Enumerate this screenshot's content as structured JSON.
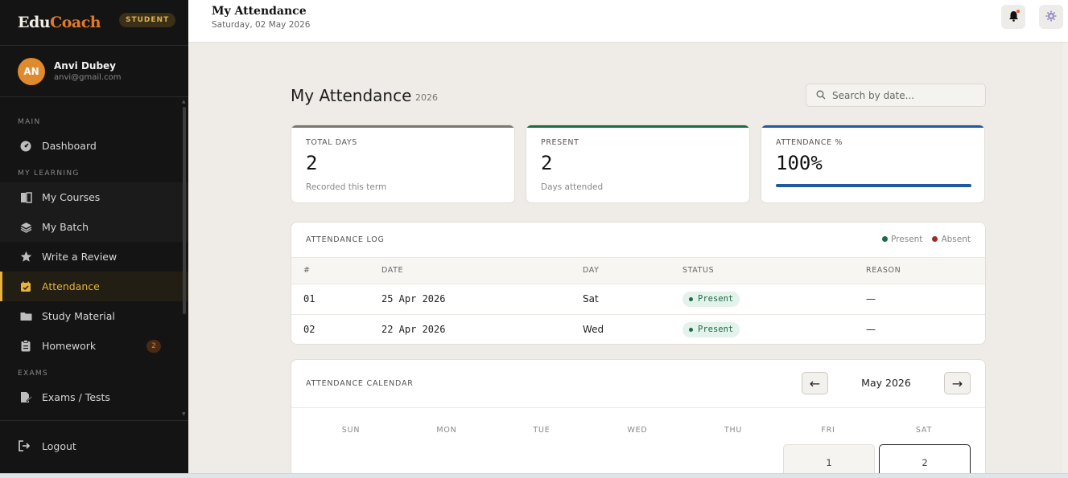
{
  "app": {
    "brand_part1": "Edu",
    "brand_part2": "Coach",
    "role_badge": "STUDENT"
  },
  "user": {
    "initials": "AN",
    "name": "Anvi Dubey",
    "email": "anvi@gmail.com"
  },
  "sidebar": {
    "sections": {
      "main": "MAIN",
      "learning": "MY LEARNING",
      "exams": "EXAMS"
    },
    "items": [
      {
        "label": "Dashboard",
        "icon": "dashboard-icon"
      },
      {
        "label": "My Courses",
        "icon": "book-icon"
      },
      {
        "label": "My Batch",
        "icon": "layers-icon"
      },
      {
        "label": "Write a Review",
        "icon": "star-icon"
      },
      {
        "label": "Attendance",
        "icon": "calendar-check-icon",
        "active": true
      },
      {
        "label": "Study Material",
        "icon": "folder-icon"
      },
      {
        "label": "Homework",
        "icon": "clipboard-icon",
        "badge": "2"
      },
      {
        "label": "Exams / Tests",
        "icon": "pencil-doc-icon"
      }
    ],
    "logout_label": "Logout"
  },
  "topbar": {
    "title": "My Attendance",
    "date": "Saturday, 02 May 2026"
  },
  "page": {
    "title": "My Attendance",
    "year": "2026",
    "search_placeholder": "Search by date..."
  },
  "stats": {
    "total": {
      "label": "TOTAL DAYS",
      "value": "2",
      "sub": "Recorded this term",
      "accent": "#6b6b6b"
    },
    "present": {
      "label": "PRESENT",
      "value": "2",
      "sub": "Days attended",
      "accent": "#1b6b45"
    },
    "percent": {
      "label": "ATTENDANCE %",
      "value": "100%",
      "fill": 1.0,
      "accent": "#1f5aa0"
    }
  },
  "log": {
    "title": "ATTENDANCE LOG",
    "legend_present": "Present",
    "legend_absent": "Absent",
    "present_color": "#1b6b45",
    "absent_color": "#a02a2a",
    "columns": [
      "#",
      "DATE",
      "DAY",
      "STATUS",
      "REASON"
    ],
    "rows": [
      {
        "num": "01",
        "date": "25 Apr 2026",
        "day": "Sat",
        "status": "Present",
        "reason": "—"
      },
      {
        "num": "02",
        "date": "22 Apr 2026",
        "day": "Wed",
        "status": "Present",
        "reason": "—"
      }
    ]
  },
  "calendar": {
    "title": "ATTENDANCE CALENDAR",
    "month": "May 2026",
    "prev_label": "←",
    "next_label": "→",
    "weekdays": [
      "SUN",
      "MON",
      "TUE",
      "WED",
      "THU",
      "FRI",
      "SAT"
    ],
    "days": [
      "1",
      "2"
    ]
  }
}
